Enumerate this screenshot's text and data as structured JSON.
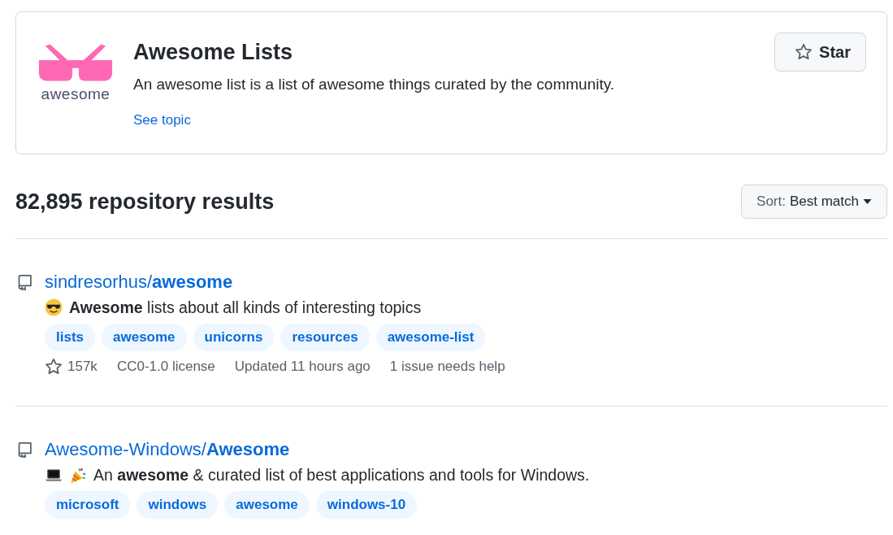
{
  "topic": {
    "logo_text": "awesome",
    "title": "Awesome Lists",
    "description": "An awesome list is a list of awesome things curated by the community.",
    "link": "See topic",
    "star_button": "Star"
  },
  "results_heading": "82,895 repository results",
  "sort": {
    "label": "Sort:",
    "value": "Best match"
  },
  "repositories": [
    {
      "name": "sindresorhus/**awesome**",
      "icons": [
        {
          "kind": "sunglasses"
        }
      ],
      "description": "**Awesome** lists about all kinds of interesting topics",
      "topics": [
        "lists",
        "awesome",
        "unicorns",
        "resources",
        "awesome-list"
      ],
      "stars": "157k",
      "license": "CC0-1.0 license",
      "updated": "Updated 11 hours ago",
      "issues": "1 issue needs help"
    },
    {
      "name": "Awesome-Windows/**Awesome**",
      "icons": [
        {
          "kind": "laptop"
        },
        {
          "kind": "party"
        }
      ],
      "description": "An **awesome** & curated list of best applications and tools for Windows.",
      "topics": [
        "microsoft",
        "windows",
        "awesome",
        "windows-10"
      ]
    }
  ]
}
